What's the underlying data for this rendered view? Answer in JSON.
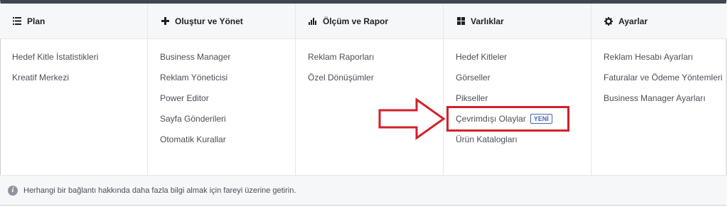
{
  "columns": [
    {
      "icon": "list-icon",
      "title": "Plan",
      "items": [
        {
          "label": "Hedef Kitle İstatistikleri"
        },
        {
          "label": "Kreatif Merkezi"
        }
      ]
    },
    {
      "icon": "plus-icon",
      "title": "Oluştur ve Yönet",
      "items": [
        {
          "label": "Business Manager"
        },
        {
          "label": "Reklam Yöneticisi"
        },
        {
          "label": "Power Editor"
        },
        {
          "label": "Sayfa Gönderileri"
        },
        {
          "label": "Otomatik Kurallar"
        }
      ]
    },
    {
      "icon": "bar-chart-icon",
      "title": "Ölçüm ve Rapor",
      "items": [
        {
          "label": "Reklam Raporları"
        },
        {
          "label": "Özel Dönüşümler"
        }
      ]
    },
    {
      "icon": "grid-icon",
      "title": "Varlıklar",
      "items": [
        {
          "label": "Hedef Kitleler"
        },
        {
          "label": "Görseller"
        },
        {
          "label": "Pikseller"
        },
        {
          "label": "Çevrimdışı Olaylar",
          "badge": "YENİ"
        },
        {
          "label": "Ürün Katalogları"
        }
      ]
    },
    {
      "icon": "gear-icon",
      "title": "Ayarlar",
      "items": [
        {
          "label": "Reklam Hesabı Ayarları"
        },
        {
          "label": "Faturalar ve Ödeme Yöntemleri"
        },
        {
          "label": "Business Manager Ayarları"
        }
      ]
    }
  ],
  "footer": {
    "icon": "info-icon",
    "text": "Herhangi bir bağlantı hakkında daha fazla bilgi almak için fareyi üzerine getirin."
  },
  "annotation": {
    "color": "#d32129"
  },
  "colors": {
    "header_bar": "#3f4652",
    "badge": "#4267b2",
    "panel_bg": "#f6f7f9"
  }
}
